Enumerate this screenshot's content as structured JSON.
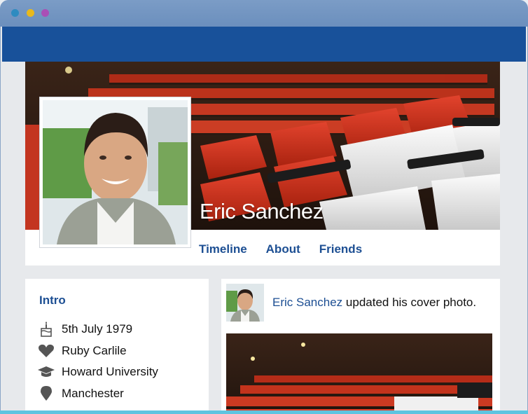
{
  "window": {
    "colors": {
      "titlebar": "#6f93c0",
      "appbar": "#18519a",
      "accent": "#1d4f93",
      "dot_red": "#2e8bc0",
      "dot_yellow": "#e9b91c",
      "dot_purple": "#a94fb6"
    }
  },
  "profile": {
    "name": "Eric Sanchez",
    "tabs": [
      {
        "label": "Timeline"
      },
      {
        "label": "About"
      },
      {
        "label": "Friends"
      }
    ]
  },
  "intro": {
    "title": "Intro",
    "items": [
      {
        "icon": "birthday-cake-icon",
        "text": "5th July 1979"
      },
      {
        "icon": "heart-icon",
        "text": "Ruby Carlile"
      },
      {
        "icon": "graduation-cap-icon",
        "text": "Howard University"
      },
      {
        "icon": "location-pin-icon",
        "text": "Manchester"
      }
    ]
  },
  "post": {
    "author": "Eric Sanchez",
    "action": "updated his cover photo."
  }
}
